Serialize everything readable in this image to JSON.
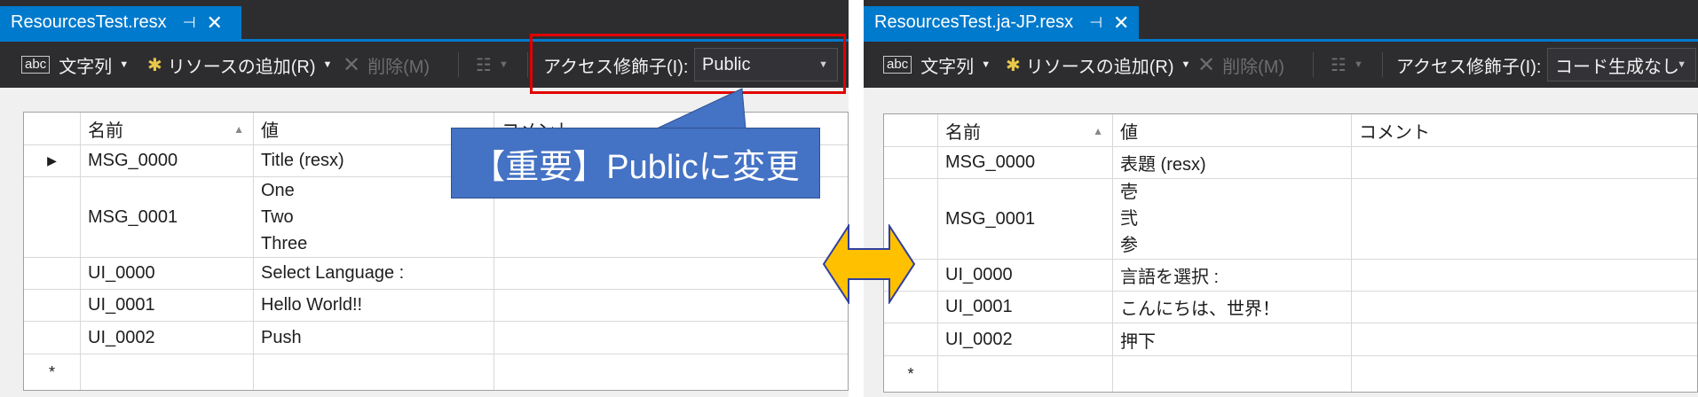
{
  "left": {
    "tab": {
      "title": "ResourcesTest.resx",
      "pin": "⊣",
      "close": "✕"
    },
    "toolbar": {
      "strings_icon": "abc",
      "strings_label": "文字列",
      "add_label": "リソースの追加(R)",
      "delete_label": "削除(M)",
      "access_label": "アクセス修飾子(I):",
      "access_value": "Public"
    },
    "grid": {
      "headers": [
        "名前",
        "値",
        "コメント"
      ],
      "rows": [
        {
          "marker": "▶",
          "name": "MSG_0000",
          "value": [
            "Title (resx)"
          ],
          "comment": ""
        },
        {
          "marker": "",
          "name": "MSG_0001",
          "value": [
            "One",
            "Two",
            "Three"
          ],
          "comment": ""
        },
        {
          "marker": "",
          "name": "UI_0000",
          "value": [
            "Select Language :"
          ],
          "comment": ""
        },
        {
          "marker": "",
          "name": "UI_0001",
          "value": [
            "Hello World!!"
          ],
          "comment": ""
        },
        {
          "marker": "",
          "name": "UI_0002",
          "value": [
            "Push"
          ],
          "comment": ""
        }
      ],
      "new_row_marker": "*"
    }
  },
  "right": {
    "tab": {
      "title": "ResourcesTest.ja-JP.resx",
      "pin": "⊣",
      "close": "✕"
    },
    "toolbar": {
      "strings_icon": "abc",
      "strings_label": "文字列",
      "add_label": "リソースの追加(R)",
      "delete_label": "削除(M)",
      "access_label": "アクセス修飾子(I):",
      "access_value": "コード生成なし"
    },
    "grid": {
      "headers": [
        "名前",
        "値",
        "コメント"
      ],
      "rows": [
        {
          "marker": "",
          "name": "MSG_0000",
          "value": [
            "表題 (resx)"
          ],
          "comment": ""
        },
        {
          "marker": "",
          "name": "MSG_0001",
          "value": [
            "壱",
            "弐",
            "参"
          ],
          "comment": ""
        },
        {
          "marker": "",
          "name": "UI_0000",
          "value": [
            "言語を選択 :"
          ],
          "comment": ""
        },
        {
          "marker": "",
          "name": "UI_0001",
          "value": [
            "こんにちは、世界！"
          ],
          "comment": ""
        },
        {
          "marker": "",
          "name": "UI_0002",
          "value": [
            "押下"
          ],
          "comment": ""
        }
      ],
      "new_row_marker": "*"
    }
  },
  "annotation": {
    "callout_text": "【重要】Publicに変更",
    "callout_color": "#4472c4",
    "highlight_color": "#e00000",
    "swap_arrow_color": "#ffc000"
  }
}
